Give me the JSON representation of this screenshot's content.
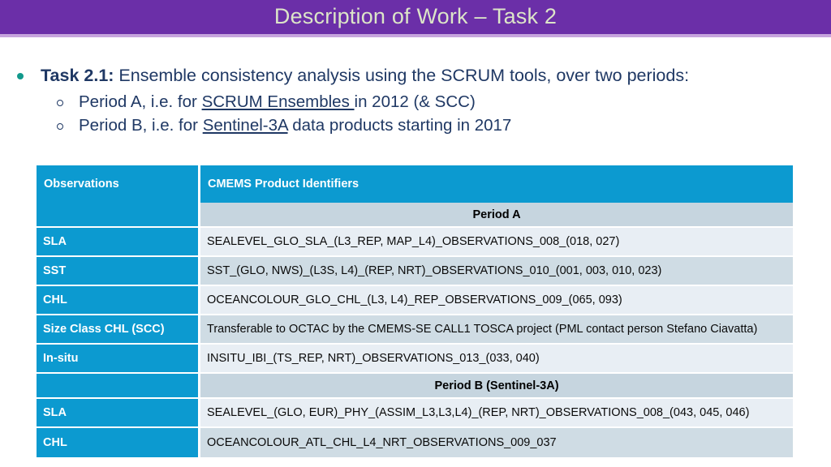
{
  "slide": {
    "title": "Description of Work – Task 2",
    "accent_purple": "#6B2FA8",
    "accent_blue": "#0C9AD0",
    "text_navy": "#1F3864",
    "bullet_teal": "#12998C",
    "title_text_color": "#DCE5C8"
  },
  "bullets": {
    "level1": {
      "label_bold": "Task 2.1:",
      "label_rest": " Ensemble consistency analysis using the SCRUM tools, over two periods:"
    },
    "level2": [
      {
        "pre": "Period A, i.e. for ",
        "underlined": "SCRUM Ensembles ",
        "post": "in 2012 (& SCC)"
      },
      {
        "pre": "Period B, i.e. for ",
        "underlined": "Sentinel-3A",
        "post": " data products starting in 2017"
      }
    ]
  },
  "table": {
    "headers": [
      "Observations",
      "CMEMS Product Identifiers"
    ],
    "rows": [
      {
        "kind": "section",
        "obs": "",
        "product": "Period A"
      },
      {
        "kind": "data",
        "band": "a",
        "obs": "SLA",
        "product": "SEALEVEL_GLO_SLA_(L3_REP, MAP_L4)_OBSERVATIONS_008_(018, 027)"
      },
      {
        "kind": "data",
        "band": "b",
        "obs": "SST",
        "product": "SST_(GLO, NWS)_(L3S, L4)_(REP, NRT)_OBSERVATIONS_010_(001, 003, 010, 023)"
      },
      {
        "kind": "data",
        "band": "a",
        "obs": "CHL",
        "product": "OCEANCOLOUR_GLO_CHL_(L3, L4)_REP_OBSERVATIONS_009_(065, 093)"
      },
      {
        "kind": "data",
        "band": "b",
        "obs": "Size Class CHL (SCC)",
        "product": "Transferable to OCTAC by the CMEMS-SE CALL1 TOSCA project (PML contact person Stefano Ciavatta)"
      },
      {
        "kind": "data",
        "band": "a",
        "obs": "In-situ",
        "product": "INSITU_IBI_(TS_REP, NRT)_OBSERVATIONS_013_(033, 040)"
      },
      {
        "kind": "section",
        "obs": "",
        "product": "Period B (Sentinel-3A)"
      },
      {
        "kind": "data",
        "band": "a",
        "obs": "SLA",
        "product": "SEALEVEL_(GLO, EUR)_PHY_(ASSIM_L3,L3,L4)_(REP, NRT)_OBSERVATIONS_008_(043, 045, 046)"
      },
      {
        "kind": "data",
        "band": "b",
        "obs": "CHL",
        "product": "OCEANCOLOUR_ATL_CHL_L4_NRT_OBSERVATIONS_009_037"
      }
    ]
  }
}
